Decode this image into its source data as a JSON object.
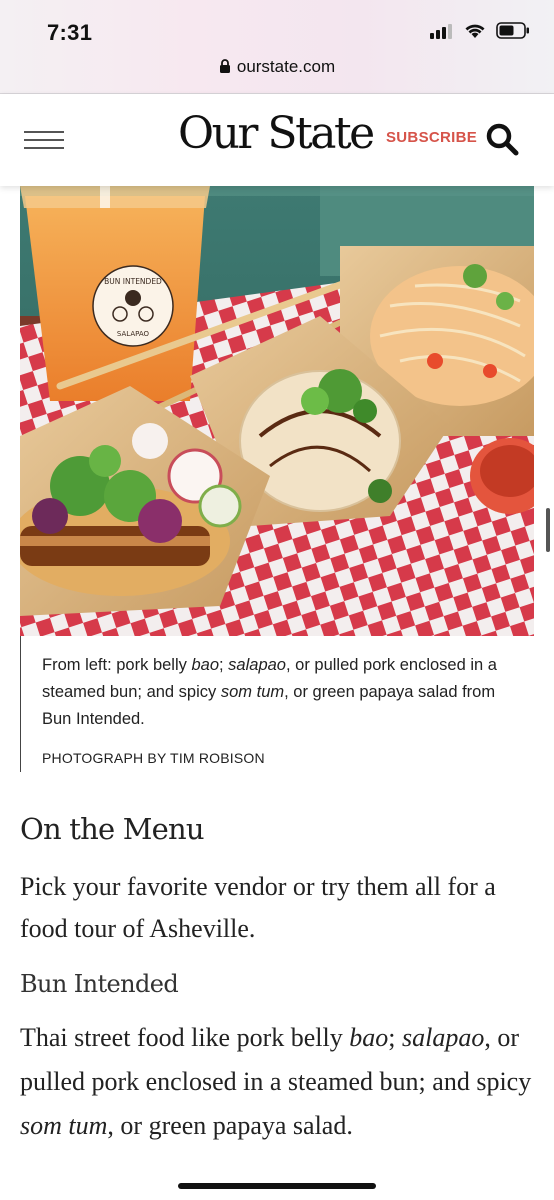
{
  "status_bar": {
    "time": "7:31",
    "icons": [
      "signal-icon",
      "wifi-icon",
      "battery-icon"
    ]
  },
  "browser": {
    "url": "ourstate.com"
  },
  "header": {
    "logo": "Our State",
    "subscribe_label": "SUBSCRIBE",
    "menu_icon": "hamburger-menu-icon",
    "search_icon": "search-icon",
    "accent_color": "#d6544a"
  },
  "photo": {
    "cup_label_top": "BUN INTENDED",
    "cup_label_bottom": "SALAPAO"
  },
  "caption": {
    "parts": [
      "From left: pork belly ",
      "bao",
      "; ",
      "salapao",
      ", or pulled pork enclosed in a steamed bun; and spicy ",
      "som tum",
      ", or green papaya salad from Bun Intended."
    ],
    "credit": "PHOTOGRAPH BY TIM ROBISON"
  },
  "article": {
    "heading": "On the Menu",
    "intro": "Pick your favorite vendor or try them all for a food tour of Asheville.",
    "vendor_heading": "Bun Intended",
    "vendor_parts": [
      "Thai street food like pork belly ",
      "bao",
      "; ",
      "salapao",
      ", or pulled pork enclosed in a steamed bun; and spicy ",
      "som tum",
      ", or green papaya salad."
    ]
  }
}
